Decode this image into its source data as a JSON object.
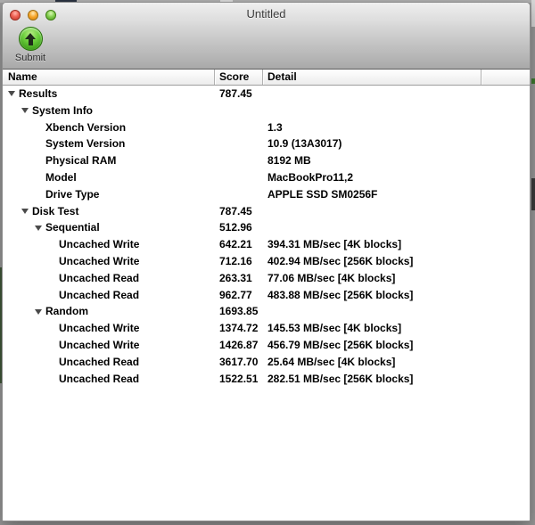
{
  "titlebar": {
    "title": "Untitled"
  },
  "toolbar": {
    "submit_label": "Submit"
  },
  "table": {
    "columns": [
      "Name",
      "Score",
      "Detail"
    ],
    "rows": [
      {
        "name": "Results",
        "level": 0,
        "expandable": true,
        "score": "787.45",
        "detail": ""
      },
      {
        "name": "System Info",
        "level": 1,
        "expandable": true,
        "score": "",
        "detail": ""
      },
      {
        "name": "Xbench Version",
        "level": 2,
        "expandable": false,
        "score": "",
        "detail": "1.3"
      },
      {
        "name": "System Version",
        "level": 2,
        "expandable": false,
        "score": "",
        "detail": "10.9 (13A3017)"
      },
      {
        "name": "Physical RAM",
        "level": 2,
        "expandable": false,
        "score": "",
        "detail": "8192 MB"
      },
      {
        "name": "Model",
        "level": 2,
        "expandable": false,
        "score": "",
        "detail": "MacBookPro11,2"
      },
      {
        "name": "Drive Type",
        "level": 2,
        "expandable": false,
        "score": "",
        "detail": "APPLE SSD SM0256F"
      },
      {
        "name": "Disk Test",
        "level": 1,
        "expandable": true,
        "score": "787.45",
        "detail": ""
      },
      {
        "name": "Sequential",
        "level": 2,
        "expandable": true,
        "score": "512.96",
        "detail": ""
      },
      {
        "name": "Uncached Write",
        "level": 3,
        "expandable": false,
        "score": "642.21",
        "detail": "394.31 MB/sec [4K blocks]"
      },
      {
        "name": "Uncached Write",
        "level": 3,
        "expandable": false,
        "score": "712.16",
        "detail": "402.94 MB/sec [256K blocks]"
      },
      {
        "name": "Uncached Read",
        "level": 3,
        "expandable": false,
        "score": "263.31",
        "detail": "77.06 MB/sec [4K blocks]"
      },
      {
        "name": "Uncached Read",
        "level": 3,
        "expandable": false,
        "score": "962.77",
        "detail": "483.88 MB/sec [256K blocks]"
      },
      {
        "name": "Random",
        "level": 2,
        "expandable": true,
        "score": "1693.85",
        "detail": ""
      },
      {
        "name": "Uncached Write",
        "level": 3,
        "expandable": false,
        "score": "1374.72",
        "detail": "145.53 MB/sec [4K blocks]"
      },
      {
        "name": "Uncached Write",
        "level": 3,
        "expandable": false,
        "score": "1426.87",
        "detail": "456.79 MB/sec [256K blocks]"
      },
      {
        "name": "Uncached Read",
        "level": 3,
        "expandable": false,
        "score": "3617.70",
        "detail": "25.64 MB/sec [4K blocks]"
      },
      {
        "name": "Uncached Read",
        "level": 3,
        "expandable": false,
        "score": "1522.51",
        "detail": "282.51 MB/sec [256K blocks]"
      }
    ]
  },
  "colors": {
    "submit_green": "#4CA91F",
    "traffic_red": "#EC6255",
    "traffic_yellow": "#F6A428",
    "traffic_green": "#7ECB4A",
    "chrome_gray": "#C9C9C9",
    "header_border": "#9E9E9E"
  }
}
